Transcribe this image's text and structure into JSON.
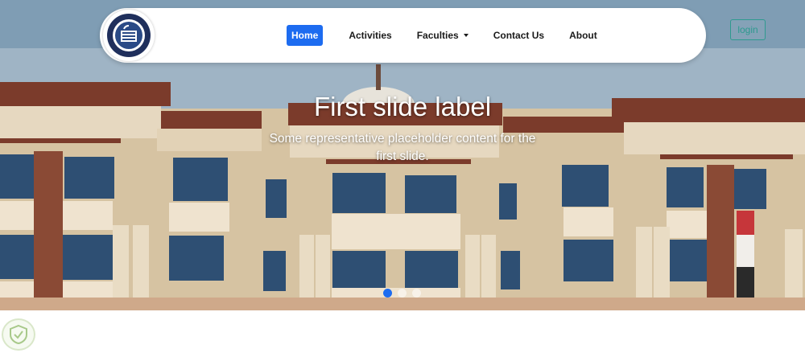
{
  "navbar": {
    "links": [
      {
        "label": "Home",
        "active": true
      },
      {
        "label": "Activities",
        "active": false
      },
      {
        "label": "Faculties",
        "active": false,
        "dropdown": true
      },
      {
        "label": "Contact Us",
        "active": false
      },
      {
        "label": "About",
        "active": false
      }
    ],
    "logo_icon": "university-seal-logo"
  },
  "login_button": {
    "label": "login"
  },
  "carousel": {
    "slide_title": "First slide label",
    "slide_text": "Some representative placeholder content for the first slide.",
    "indicator_count": 3,
    "active_index": 0
  },
  "colors": {
    "accent": "#1d6cf0",
    "login": "#2e9a8f",
    "building": "#d9c8a9",
    "trim": "#7a3a2a"
  },
  "corner_badge_icon": "shield-badge-icon"
}
